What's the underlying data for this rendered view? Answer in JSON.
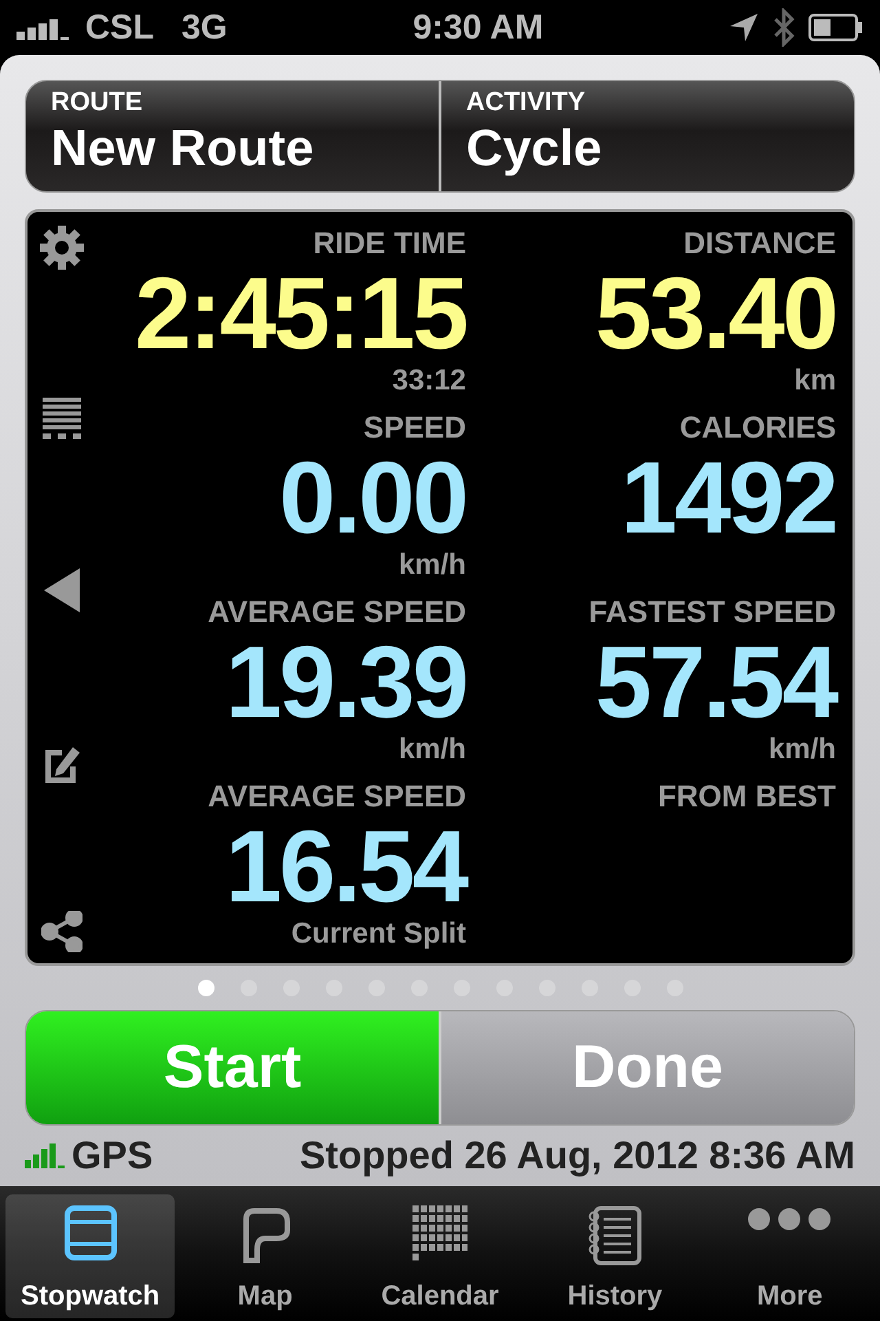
{
  "status_bar": {
    "carrier": "CSL",
    "network": "3G",
    "time": "9:30 AM"
  },
  "header": [
    {
      "label": "ROUTE",
      "value": "New Route"
    },
    {
      "label": "ACTIVITY",
      "value": "Cycle"
    }
  ],
  "stats": [
    {
      "label": "RIDE TIME",
      "value": "2:45:15",
      "unit": "33:12",
      "color": "#fcfc8c"
    },
    {
      "label": "DISTANCE",
      "value": "53.40",
      "unit": "km",
      "color": "#fcfc8c"
    },
    {
      "label": "SPEED",
      "value": "0.00",
      "unit": "km/h",
      "color": "#a4e6fc"
    },
    {
      "label": "CALORIES",
      "value": "1492",
      "color": "#a4e6fc"
    },
    {
      "label": "AVERAGE SPEED",
      "value": "19.39",
      "unit": "km/h",
      "color": "#a4e6fc"
    },
    {
      "label": "FASTEST SPEED",
      "value": "57.54",
      "unit": "km/h",
      "color": "#a4e6fc"
    },
    {
      "label": "AVERAGE SPEED",
      "value": "16.54",
      "unit": "Current Split",
      "color": "#a4e6fc"
    },
    {
      "label": "FROM BEST"
    }
  ],
  "pages": [
    {
      "selected": true
    },
    {
      "selected": false
    },
    {
      "selected": false
    },
    {
      "selected": false
    },
    {
      "selected": false
    },
    {
      "selected": false
    },
    {
      "selected": false
    },
    {
      "selected": false
    },
    {
      "selected": false
    },
    {
      "selected": false
    },
    {
      "selected": false
    },
    {
      "selected": false
    }
  ],
  "buttons": [
    {
      "label": "Start",
      "kind": "primary"
    },
    {
      "label": "Done",
      "kind": "secondary"
    }
  ],
  "gps": {
    "label": "GPS",
    "status": "Stopped 26 Aug, 2012 8:36 AM"
  },
  "tabs": [
    {
      "label": "Stopwatch",
      "kind": "stopwatch",
      "selected": true
    },
    {
      "label": "Map",
      "kind": "map",
      "selected": false
    },
    {
      "label": "Calendar",
      "kind": "calendar",
      "selected": false
    },
    {
      "label": "History",
      "kind": "history",
      "selected": false
    },
    {
      "label": "More",
      "kind": "more",
      "selected": false
    }
  ]
}
